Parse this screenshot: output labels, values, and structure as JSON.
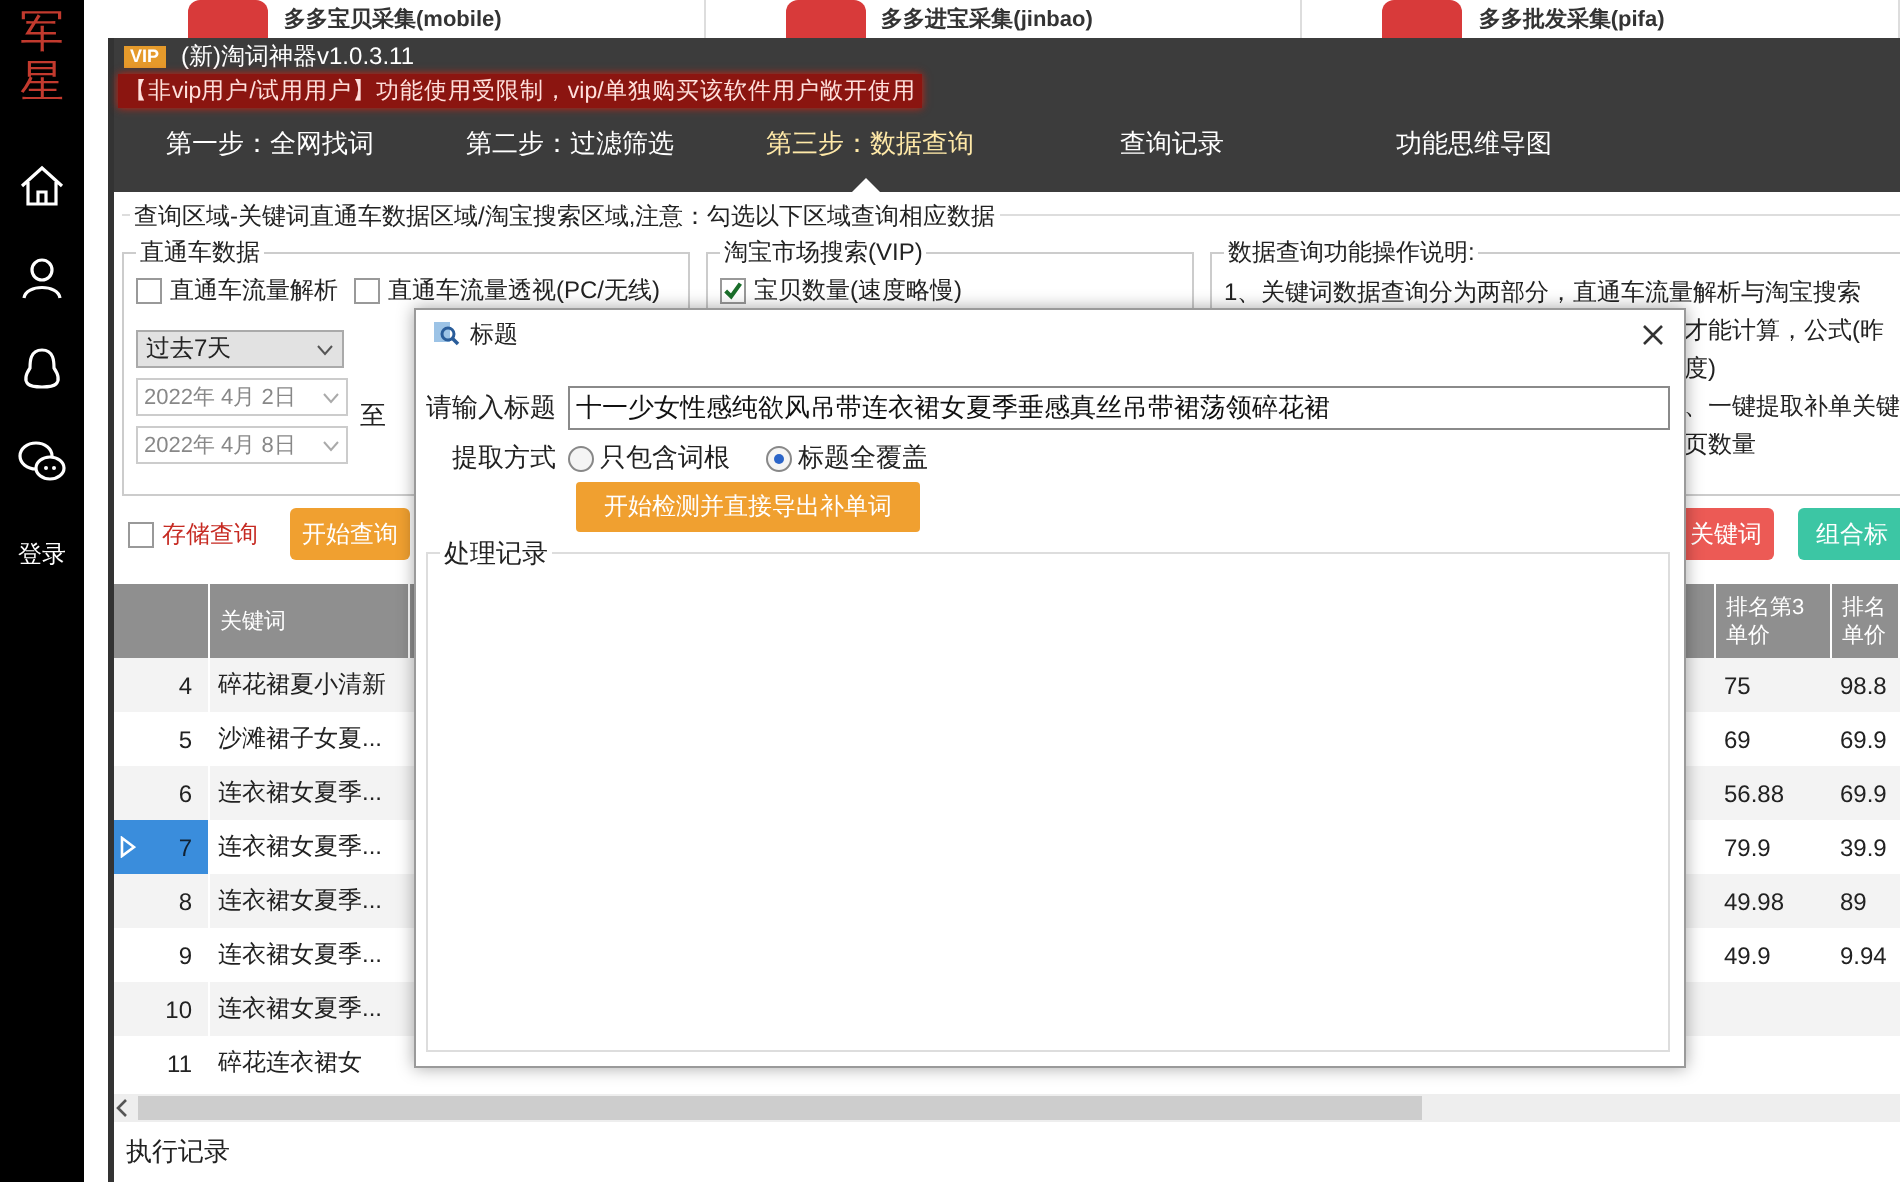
{
  "background_apps": [
    {
      "name": "多多宝贝采集(mobile)"
    },
    {
      "name": "多多进宝采集(jinbao)"
    },
    {
      "name": "多多批发采集(pifa)"
    }
  ],
  "sidebar": {
    "logo": "军星",
    "login": "登录"
  },
  "window": {
    "badge": "VIP",
    "title": "(新)淘词神器v1.0.3.11",
    "notice": "【非vip用户/试用用户】功能使用受限制，vip/单独购买该软件用户敞开使用",
    "tabs": [
      {
        "label": "第一步：全网找词",
        "selected": false
      },
      {
        "label": "第二步：过滤筛选",
        "selected": false
      },
      {
        "label": "第三步：数据查询",
        "selected": true
      },
      {
        "label": "查询记录",
        "selected": false
      },
      {
        "label": "功能思维导图",
        "selected": false
      }
    ]
  },
  "query_area": {
    "title": "查询区域-关键词直通车数据区域/淘宝搜索区域,注意：勾选以下区域查询相应数据",
    "ztc": {
      "title": "直通车数据",
      "options": [
        {
          "label": "直通车流量解析",
          "checked": false
        },
        {
          "label": "直通车流量透视(PC/无线)",
          "checked": false
        }
      ],
      "period": "过去7天",
      "date_from": "2022年 4月 2日",
      "to_label": "至",
      "date_to": "2022年 4月 8日"
    },
    "market": {
      "title": "淘宝市场搜索(VIP)",
      "options": [
        {
          "label": "宝贝数量(速度略慢)",
          "checked": true
        }
      ]
    },
    "help": {
      "title": "数据查询功能操作说明:",
      "lines": [
        {
          "text": "1、关键词数据查询分为两部分，直通车流量解析与淘宝搜索",
          "kind": "full"
        },
        {
          "text": "才能计算，公式(昨",
          "kind": "partial"
        },
        {
          "text": "度)",
          "kind": "partial"
        },
        {
          "text": "、一键提取补单关键",
          "kind": "partial"
        },
        {
          "text": "页数量",
          "kind": "partial"
        }
      ]
    }
  },
  "actions": {
    "save_query": {
      "label": "存储查询",
      "checked": false
    },
    "buttons": [
      {
        "label": "开始查询",
        "kind": "orange"
      },
      {
        "label": "关键词",
        "kind": "red"
      },
      {
        "label": "组合标",
        "kind": "teal"
      }
    ]
  },
  "table": {
    "columns": [
      {
        "label": "关键词"
      },
      {
        "label": "排名第3单价"
      },
      {
        "label": "排名单价"
      }
    ],
    "rows": [
      {
        "index": "4",
        "keyword": "碎花裙夏小清新",
        "rank3": "75",
        "rank4": "98.8",
        "selected": false
      },
      {
        "index": "5",
        "keyword": "沙滩裙子女夏...",
        "rank3": "69",
        "rank4": "69.9",
        "selected": false
      },
      {
        "index": "6",
        "keyword": "连衣裙女夏季...",
        "rank3": "56.88",
        "rank4": "69.9",
        "selected": false
      },
      {
        "index": "7",
        "keyword": "连衣裙女夏季...",
        "rank3": "79.9",
        "rank4": "39.9",
        "selected": true
      },
      {
        "index": "8",
        "keyword": "连衣裙女夏季...",
        "rank3": "49.98",
        "rank4": "89",
        "selected": false
      },
      {
        "index": "9",
        "keyword": "连衣裙女夏季...",
        "rank3": "49.9",
        "rank4": "9.94",
        "selected": false
      },
      {
        "index": "10",
        "keyword": "连衣裙女夏季...",
        "selected": false
      },
      {
        "index": "11",
        "keyword": "碎花连衣裙女",
        "selected": false
      }
    ]
  },
  "log": {
    "title": "执行记录"
  },
  "dialog": {
    "title": "标题",
    "input_label": "请输入标题",
    "value": "十一少女性感纯欲风吊带连衣裙女夏季垂感真丝吊带裙荡领碎花裙",
    "mode_label": "提取方式",
    "modes": [
      {
        "label": "只包含词根",
        "selected": false
      },
      {
        "label": "标题全覆盖",
        "selected": true
      }
    ],
    "button": "开始检测并直接导出补单词",
    "log_title": "处理记录"
  }
}
